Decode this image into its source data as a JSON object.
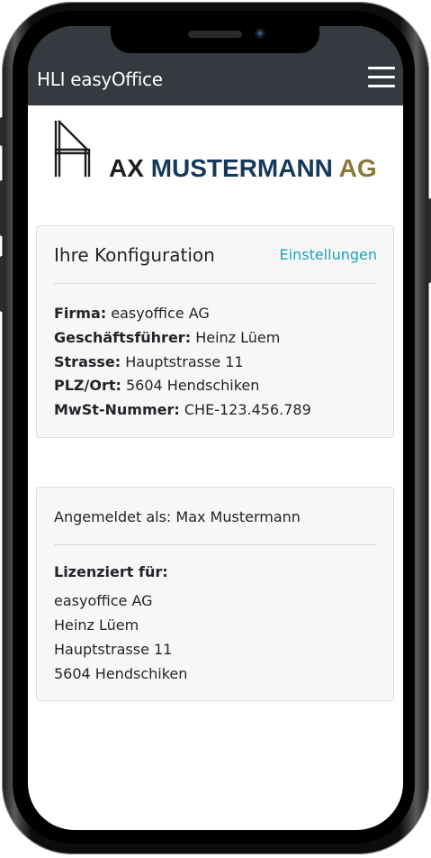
{
  "navbar": {
    "brand": "HLI easyOffice",
    "menu_icon": "hamburger-menu-icon"
  },
  "logo": {
    "part1": "AX",
    "part2": "MUSTERMANN",
    "part3": "AG",
    "colors": {
      "part1": "#1d1d1d",
      "part2": "#15395b",
      "part3": "#8a7a3a"
    }
  },
  "config": {
    "title": "Ihre Konfiguration",
    "settings_link": "Einstellungen",
    "fields": [
      {
        "label": "Firma:",
        "value": "easyoffice AG"
      },
      {
        "label": "Geschäftsführer:",
        "value": "Heinz Lüem"
      },
      {
        "label": "Strasse:",
        "value": "Hauptstrasse 11"
      },
      {
        "label": "PLZ/Ort:",
        "value": "5604 Hendschiken"
      },
      {
        "label": "MwSt-Nummer:",
        "value": "CHE-123.456.789"
      }
    ]
  },
  "account": {
    "logged_in_as": "Angemeldet als: Max Mustermann",
    "licensed_label": "Lizenziert für:",
    "license_lines": [
      "easyoffice AG",
      "Heinz Lüem",
      "Hauptstrasse 11",
      "5604 Hendschiken"
    ]
  },
  "colors": {
    "navbar_bg": "#343a40",
    "link": "#17a2b8",
    "card_bg": "#f7f7f7"
  }
}
